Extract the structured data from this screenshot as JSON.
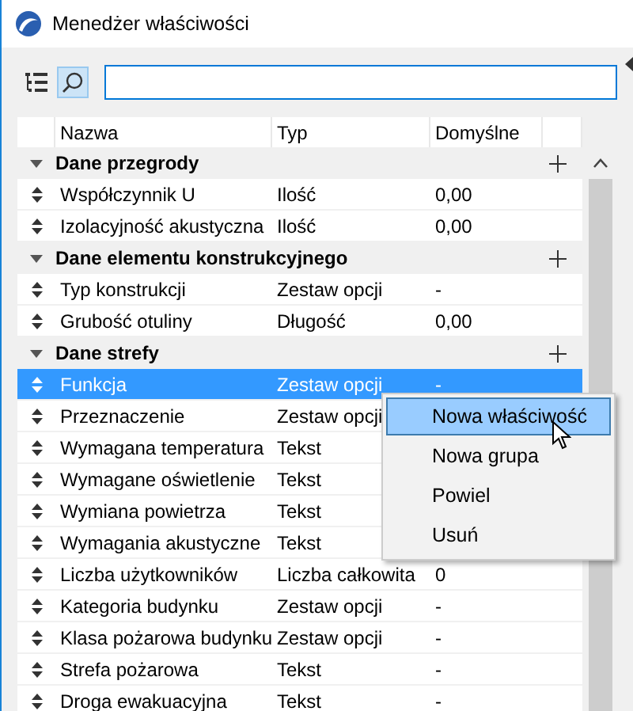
{
  "window": {
    "title": "Menedżer właściwości"
  },
  "toolbar": {
    "buttons": [
      {
        "kind": "list",
        "selected": false
      },
      {
        "kind": "search",
        "selected": true
      }
    ]
  },
  "table": {
    "columns": [
      "Nazwa",
      "Typ",
      "Domyślne"
    ],
    "groups": [
      {
        "name": "Dane przegrody",
        "expanded": true,
        "rows": [
          {
            "name": "Współczynnik U",
            "type": "Ilość",
            "default": "0,00",
            "selected": false
          },
          {
            "name": "Izolacyjność akustyczna",
            "type": "Ilość",
            "default": "0,00",
            "selected": false
          }
        ]
      },
      {
        "name": "Dane elementu konstrukcyjnego",
        "expanded": true,
        "rows": [
          {
            "name": "Typ konstrukcji",
            "type": "Zestaw opcji",
            "default": "-",
            "selected": false
          },
          {
            "name": "Grubość otuliny",
            "type": "Długość",
            "default": "0,00",
            "selected": false
          }
        ]
      },
      {
        "name": "Dane strefy",
        "expanded": true,
        "rows": [
          {
            "name": "Funkcja",
            "type": "Zestaw opcji",
            "default": "-",
            "selected": true
          },
          {
            "name": "Przeznaczenie",
            "type": "Zestaw opcji",
            "selected": false
          },
          {
            "name": "Wymagana temperatura",
            "type": "Tekst",
            "selected": false
          },
          {
            "name": "Wymagane oświetlenie",
            "type": "Tekst",
            "selected": false
          },
          {
            "name": "Wymiana powietrza",
            "type": "Tekst",
            "selected": false
          },
          {
            "name": "Wymagania akustyczne",
            "type": "Tekst",
            "selected": false
          },
          {
            "name": "Liczba użytkowników",
            "type": "Liczba całkowita",
            "default": "0",
            "selected": false
          },
          {
            "name": "Kategoria budynku",
            "type": "Zestaw opcji",
            "default": "-",
            "selected": false
          },
          {
            "name": "Klasa pożarowa budynku",
            "type": "Zestaw opcji",
            "default": "-",
            "selected": false
          },
          {
            "name": "Strefa pożarowa",
            "type": "Tekst",
            "default": "-",
            "selected": false
          },
          {
            "name": "Droga ewakuacyjna",
            "type": "Tekst",
            "default": "-",
            "selected": false
          }
        ]
      }
    ]
  },
  "context_menu": {
    "items": [
      {
        "label": "Nowa właściwość",
        "selected": true
      },
      {
        "label": "Nowa grupa",
        "selected": false
      },
      {
        "label": "Powiel",
        "selected": false
      },
      {
        "label": "Usuń",
        "selected": false
      }
    ]
  }
}
